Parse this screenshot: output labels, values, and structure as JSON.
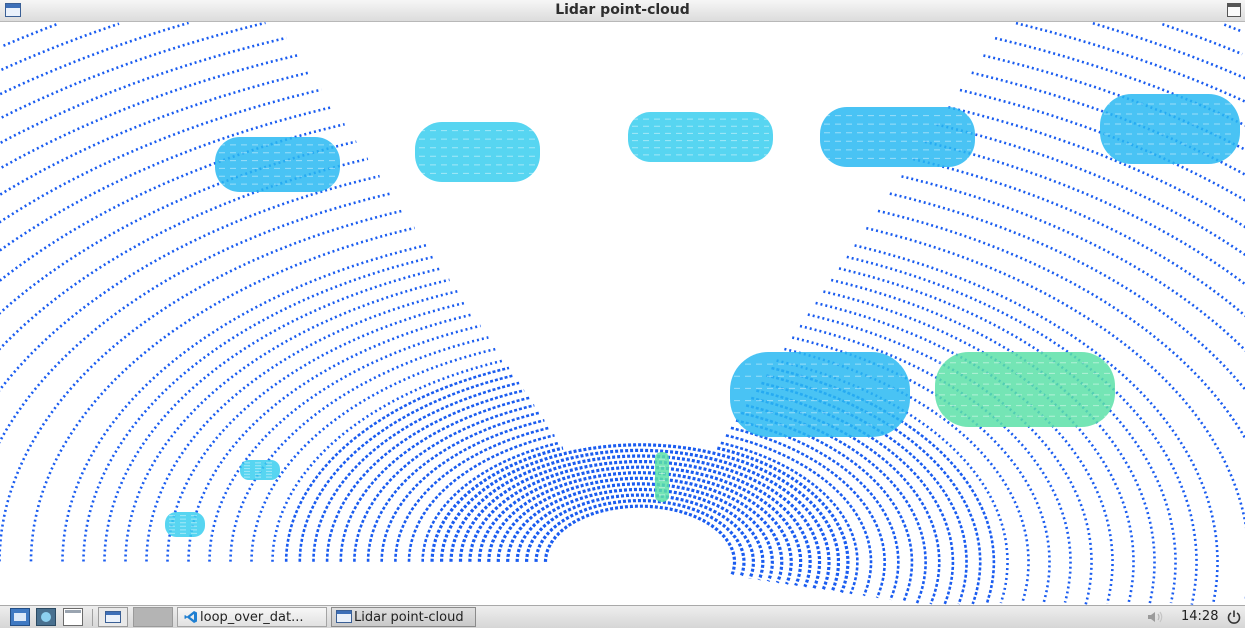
{
  "window": {
    "title": "Lidar point-cloud"
  },
  "viewer": {
    "colors": {
      "ground": "#1a5cf0",
      "object_high": "#29b8f2",
      "object_mid": "#3aceee",
      "object_green": "#5ce0a8",
      "background": "#ffffff"
    }
  },
  "taskbar": {
    "tasks": [
      {
        "label": "loop_over_dat...",
        "icon": "vscode-icon"
      },
      {
        "label": "Lidar point-cloud",
        "icon": "window-icon"
      }
    ],
    "clock": "14:28"
  }
}
